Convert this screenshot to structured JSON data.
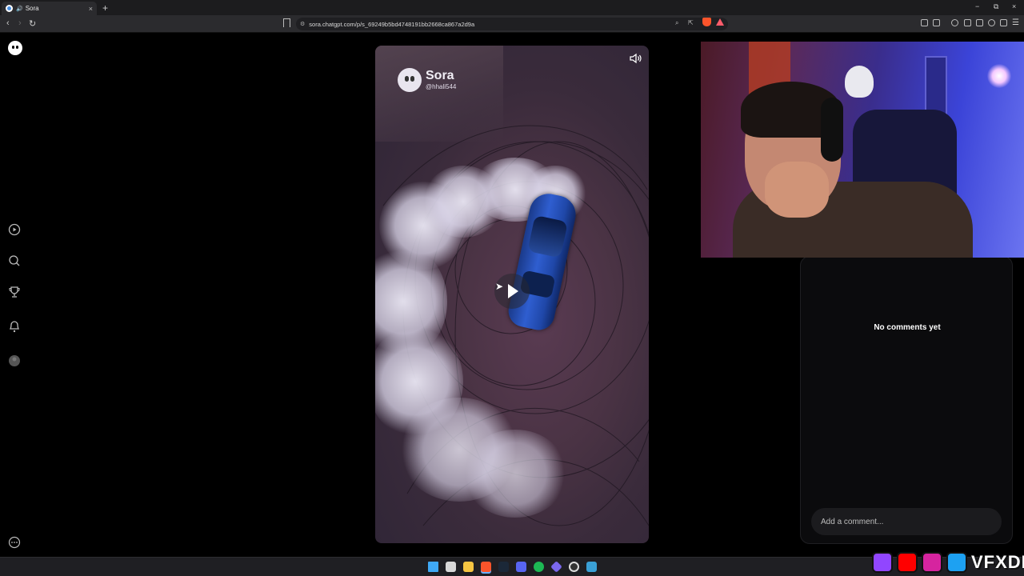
{
  "browser": {
    "tab_title": "Sora",
    "new_tab_symbol": "+",
    "tab_close_symbol": "×",
    "address": "sora.chatgpt.com/p/s_69249b5bd4748191bb2668ca867a2d9a",
    "window_buttons": [
      "−",
      "⧉",
      "×"
    ]
  },
  "video": {
    "watermark_name": "Sora",
    "watermark_handle": "@hhali544"
  },
  "comments": {
    "empty_text": "No comments yet",
    "input_placeholder": "Add a comment..."
  },
  "overlay": {
    "brand_text": "VFXDI"
  },
  "colors": {
    "page_bg": "#000000",
    "panel_bg": "#0b0b0d",
    "twitch": "#9146ff",
    "youtube": "#ff0000",
    "instagram": "#d6249f",
    "twitter": "#1da1f2"
  },
  "icons": {
    "sidebar": [
      "sora-logo-icon",
      "video-icon",
      "search-icon",
      "trophy-icon",
      "bell-icon",
      "profile-icon",
      "more-icon"
    ],
    "player": [
      "volume-icon",
      "play-icon"
    ]
  }
}
